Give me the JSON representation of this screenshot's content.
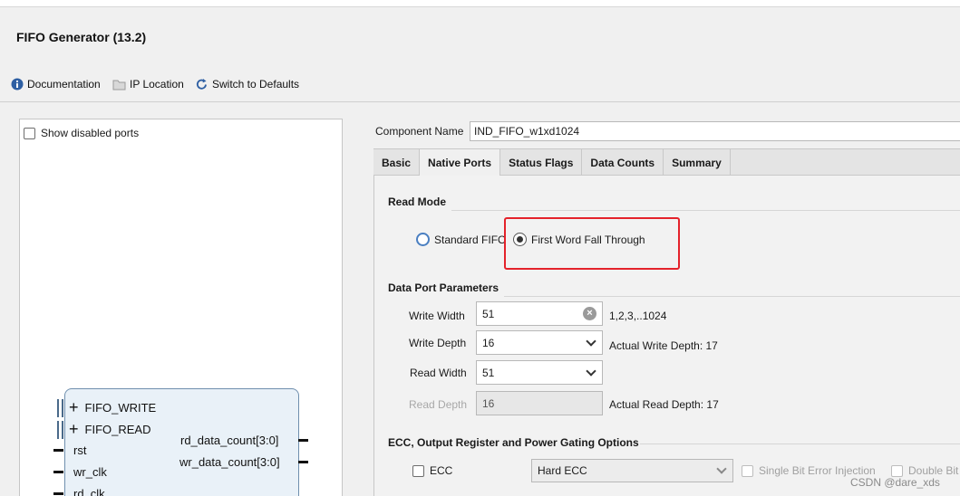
{
  "window": {
    "title": "FIFO Generator (13.2)"
  },
  "toolbar": {
    "documentation": "Documentation",
    "ip_location": "IP Location",
    "switch_defaults": "Switch to Defaults"
  },
  "symbol_panel": {
    "show_disabled_ports": "Show disabled ports",
    "interfaces": [
      "FIFO_WRITE",
      "FIFO_READ"
    ],
    "input_ports": [
      "rst",
      "wr_clk",
      "rd_clk"
    ],
    "output_ports": [
      "rd_data_count[3:0]",
      "wr_data_count[3:0]"
    ]
  },
  "component": {
    "label": "Component Name",
    "value": "IND_FIFO_w1xd1024"
  },
  "tabs": [
    "Basic",
    "Native Ports",
    "Status Flags",
    "Data Counts",
    "Summary"
  ],
  "active_tab": "Native Ports",
  "read_mode": {
    "title": "Read Mode",
    "standard": "Standard FIFO",
    "fwft": "First Word Fall Through",
    "selected": "First Word Fall Through"
  },
  "data_port": {
    "title": "Data Port Parameters",
    "write_width_label": "Write Width",
    "write_width": "51",
    "write_width_range": "1,2,3,..1024",
    "write_depth_label": "Write Depth",
    "write_depth": "16",
    "actual_write_depth": "Actual Write Depth: 17",
    "read_width_label": "Read Width",
    "read_width": "51",
    "read_depth_label": "Read Depth",
    "read_depth": "16",
    "actual_read_depth": "Actual Read Depth: 17"
  },
  "ecc": {
    "title": "ECC, Output Register and Power Gating Options",
    "ecc_label": "ECC",
    "ecc_type": "Hard ECC",
    "single_bit": "Single Bit Error Injection",
    "double_bit": "Double Bit"
  },
  "watermark": "CSDN @dare_xds",
  "colors": {
    "highlight": "#e4222b",
    "radio_accent": "#4a7fc1",
    "symbol_fill": "#e9f1f8"
  }
}
